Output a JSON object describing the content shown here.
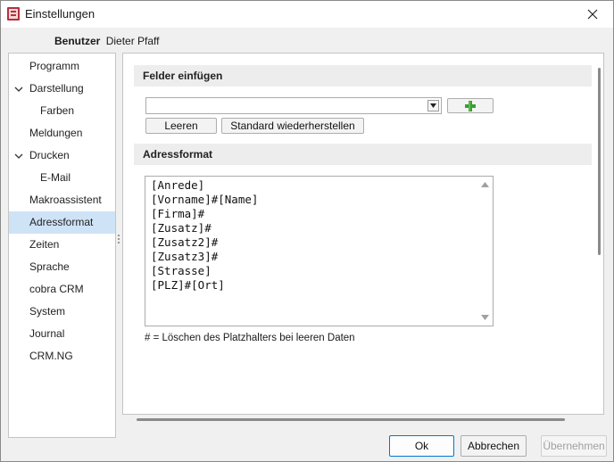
{
  "window": {
    "title": "Einstellungen"
  },
  "user": {
    "label": "Benutzer",
    "name": "Dieter Pfaff"
  },
  "sidebar": {
    "items": [
      {
        "label": "Programm",
        "expanded": false,
        "level": 0
      },
      {
        "label": "Darstellung",
        "expanded": true,
        "level": 0,
        "chevron": "✓"
      },
      {
        "label": "Farben",
        "level": 1
      },
      {
        "label": "Meldungen",
        "level": 0
      },
      {
        "label": "Drucken",
        "expanded": true,
        "level": 0,
        "chevron": "✓"
      },
      {
        "label": "E-Mail",
        "level": 1
      },
      {
        "label": "Makroassistent",
        "level": 0
      },
      {
        "label": "Adressformat",
        "level": 0,
        "active": true
      },
      {
        "label": "Zeiten",
        "level": 0
      },
      {
        "label": "Sprache",
        "level": 0
      },
      {
        "label": "cobra CRM",
        "level": 0
      },
      {
        "label": "System",
        "level": 0
      },
      {
        "label": "Journal",
        "level": 0
      },
      {
        "label": "CRM.NG",
        "level": 0
      }
    ]
  },
  "felder": {
    "heading": "Felder einfügen",
    "combo_value": "",
    "add_icon": "plus-icon",
    "clear_label": "Leeren",
    "restore_label": "Standard wiederherstellen"
  },
  "adressformat": {
    "heading": "Adressformat",
    "lines": [
      "[Anrede]",
      "[Vorname]#[Name]",
      "[Firma]#",
      "[Zusatz]#",
      "[Zusatz2]#",
      "[Zusatz3]#",
      "[Strasse]",
      "[PLZ]#[Ort]"
    ],
    "hint": "# = Löschen des Platzhalters bei leeren Daten"
  },
  "footer": {
    "ok_label": "Ok",
    "cancel_label": "Abbrechen",
    "apply_label": "Übernehmen"
  },
  "colors": {
    "active_item": "#cfe3f7",
    "section_header": "#ededed",
    "plus_green": "#3aa02f",
    "primary_border": "#0078d4"
  }
}
